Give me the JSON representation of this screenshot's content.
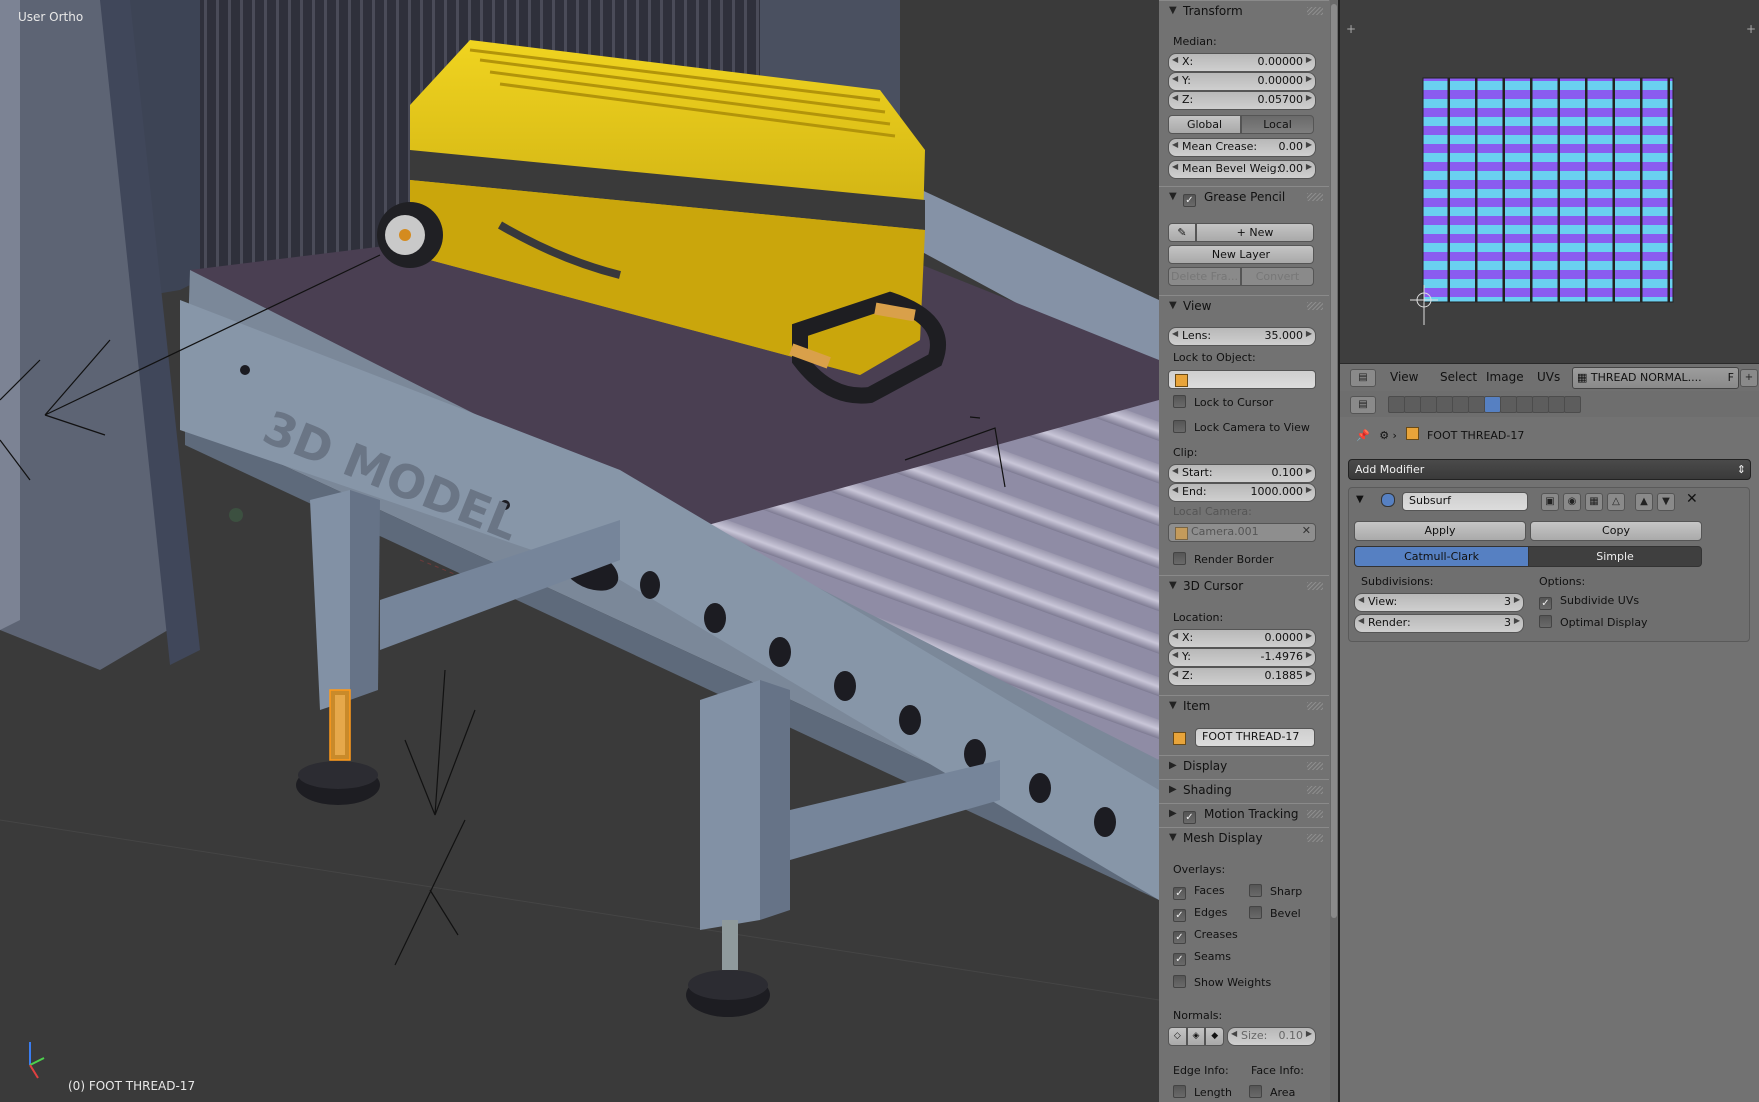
{
  "viewport": {
    "title": "User Ortho",
    "object_label": "(0) FOOT THREAD-17",
    "model_text": "3D MODEL"
  },
  "npanel": {
    "transform": {
      "header": "Transform",
      "median_label": "Median:",
      "x_label": "X:",
      "x_value": "0.00000",
      "y_label": "Y:",
      "y_value": "0.00000",
      "z_label": "Z:",
      "z_value": "0.05700",
      "global_label": "Global",
      "local_label": "Local",
      "mean_crease_label": "Mean Crease:",
      "mean_crease_value": "0.00",
      "mean_bevel_label": "Mean Bevel Weig:",
      "mean_bevel_value": "0.00"
    },
    "grease_pencil": {
      "header": "Grease Pencil",
      "new_label": "New",
      "new_layer_label": "New Layer",
      "delete_frame_label": "Delete Fra...",
      "convert_label": "Convert"
    },
    "view": {
      "header": "View",
      "lens_label": "Lens:",
      "lens_value": "35.000",
      "lock_to_object_label": "Lock to Object:",
      "lock_to_cursor_label": "Lock to Cursor",
      "lock_camera_label": "Lock Camera to View",
      "clip_label": "Clip:",
      "start_label": "Start:",
      "start_value": "0.100",
      "end_label": "End:",
      "end_value": "1000.000",
      "local_camera_label": "Local Camera:",
      "camera_value": "Camera.001",
      "render_border_label": "Render Border"
    },
    "cursor": {
      "header": "3D Cursor",
      "location_label": "Location:",
      "x_label": "X:",
      "x_value": "0.0000",
      "y_label": "Y:",
      "y_value": "-1.4976",
      "z_label": "Z:",
      "z_value": "0.1885"
    },
    "item": {
      "header": "Item",
      "name_value": "FOOT THREAD-17"
    },
    "collapsed": {
      "display": "Display",
      "shading": "Shading",
      "motion_tracking": "Motion Tracking"
    },
    "mesh_display": {
      "header": "Mesh Display",
      "overlays_label": "Overlays:",
      "faces": "Faces",
      "sharp": "Sharp",
      "edges": "Edges",
      "bevel": "Bevel",
      "creases": "Creases",
      "seams": "Seams",
      "show_weights": "Show Weights",
      "normals_label": "Normals:",
      "size_label": "Size:",
      "size_value": "0.10",
      "edge_info_label": "Edge Info:",
      "face_info_label": "Face Info:",
      "length": "Length",
      "area": "Area"
    }
  },
  "uv_header": {
    "view": "View",
    "select": "Select",
    "image": "Image",
    "uvs": "UVs",
    "image_name": "THREAD NORMAL....",
    "f_label": "F"
  },
  "properties": {
    "object_name": "FOOT THREAD-17",
    "add_modifier": "Add Modifier",
    "modifier_name": "Subsurf",
    "apply": "Apply",
    "copy": "Copy",
    "catmull": "Catmull-Clark",
    "simple": "Simple",
    "subdivisions_label": "Subdivisions:",
    "view_label": "View:",
    "view_value": "3",
    "render_label": "Render:",
    "render_value": "3",
    "options_label": "Options:",
    "subdivide_uvs": "Subdivide UVs",
    "optimal_display": "Optimal Display"
  },
  "colors": {
    "viewport_bg": "#3a3a3a",
    "panel_bg": "#727272",
    "accent_blue": "#5680c2",
    "suitcase_yellow": "#d4b30f",
    "uv_purple": "#8a5cf0",
    "uv_cyan": "#6ad0f0"
  }
}
